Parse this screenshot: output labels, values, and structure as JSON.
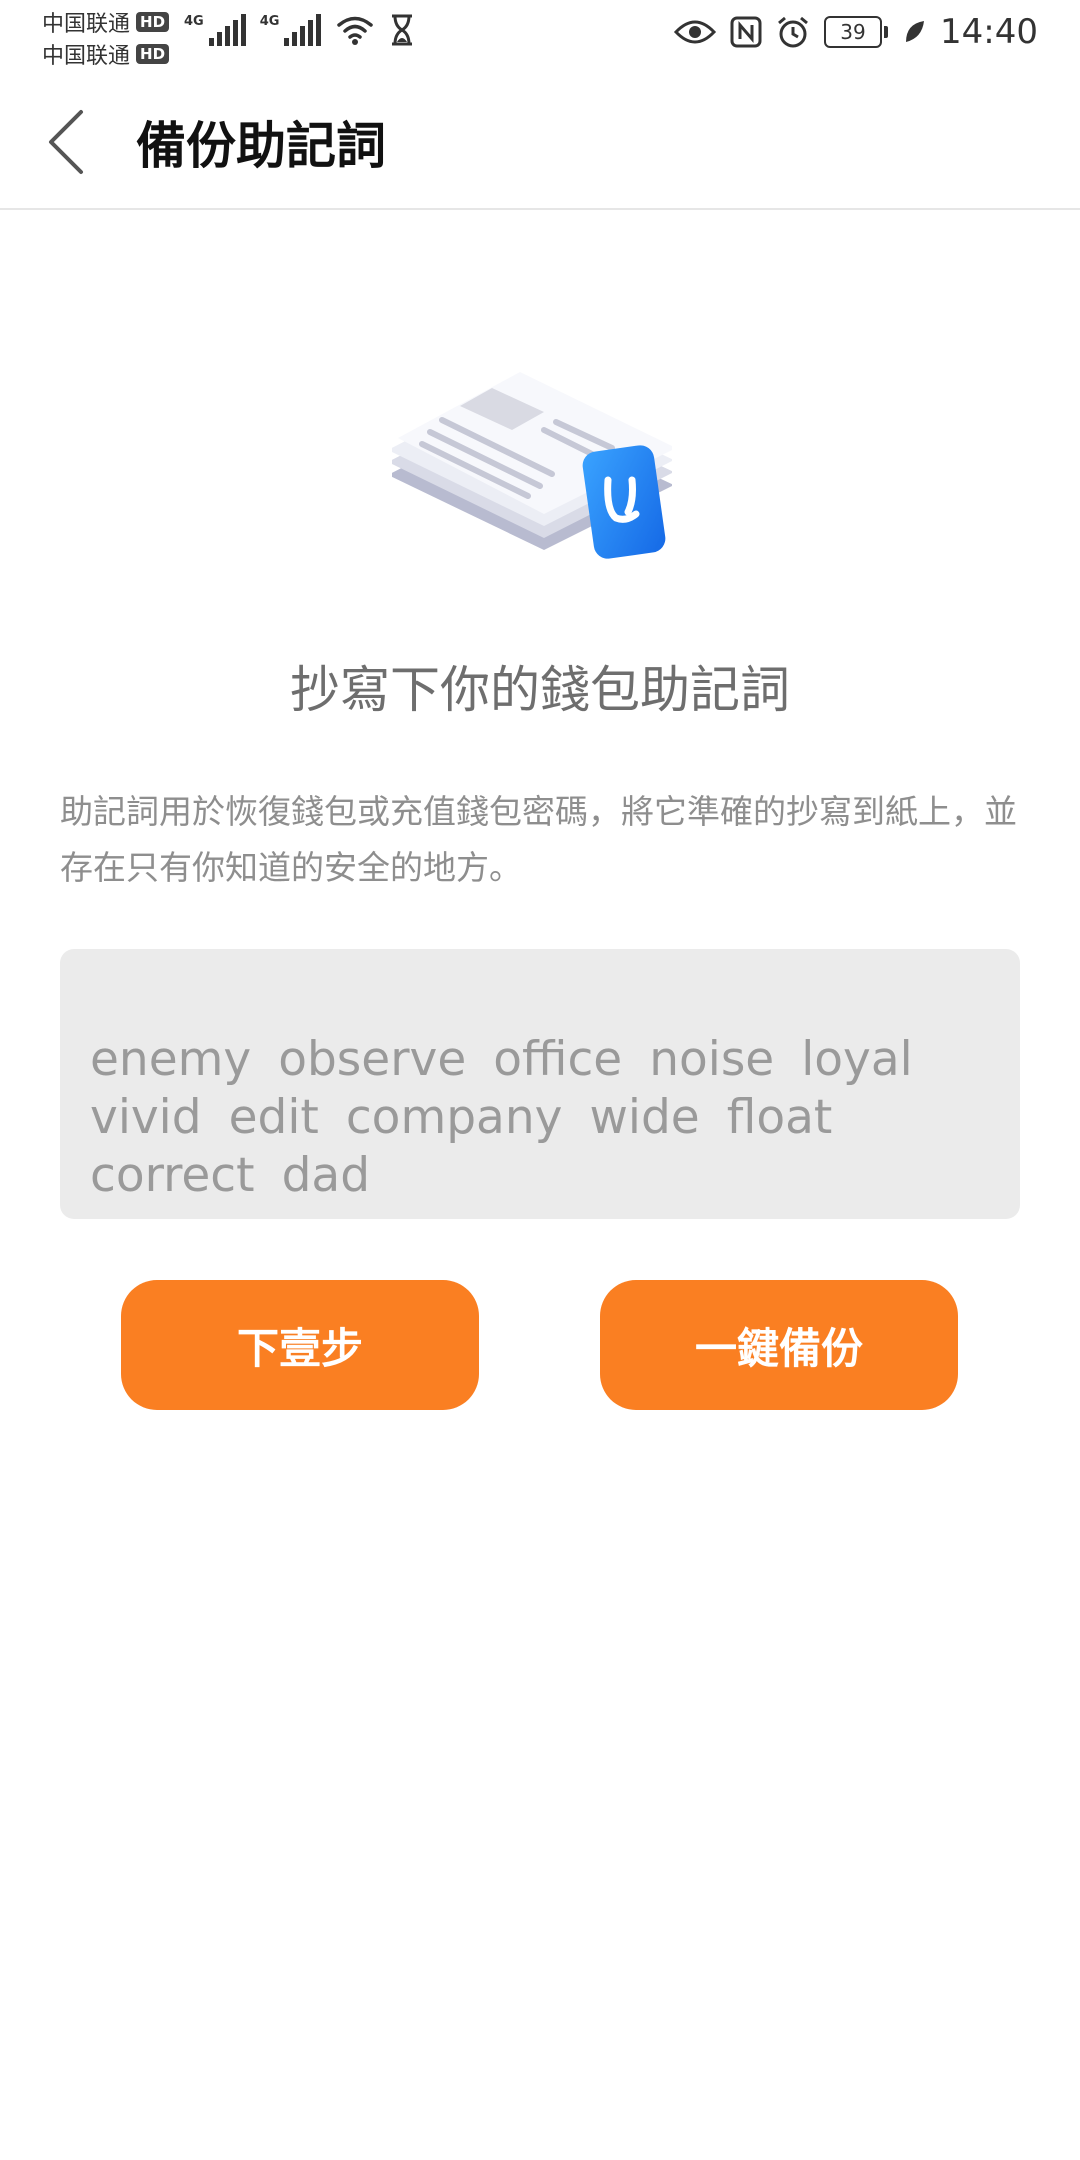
{
  "status_bar": {
    "carriers": [
      {
        "name": "中国联通",
        "badge": "HD"
      },
      {
        "name": "中国联通",
        "badge": "HD"
      }
    ],
    "network_1": "4G",
    "network_2": "4G",
    "battery_level": "39",
    "time": "14:40",
    "icons": [
      "signal-icon",
      "signal-icon",
      "wifi-icon",
      "hourglass-icon",
      "eye-icon",
      "nfc-icon",
      "alarm-icon",
      "battery-icon",
      "leaf-icon"
    ]
  },
  "header": {
    "title": "備份助記詞",
    "back_icon": "chevron-left-icon"
  },
  "main": {
    "illustration_icon": "document-stack-wallet-icon",
    "heading": "抄寫下你的錢包助記詞",
    "description": "助記詞用於恢復錢包或充值錢包密碼，將它準確的抄寫到紙上，並存在只有你知道的安全的地方。",
    "mnemonic_words": [
      "enemy",
      "observe",
      "office",
      "noise",
      "loyal",
      "vivid",
      "edit",
      "company",
      "wide",
      "float",
      "correct",
      "dad"
    ]
  },
  "buttons": {
    "next_label": "下壹步",
    "backup_label": "一鍵備份"
  },
  "colors": {
    "accent": "#fa7f22",
    "mnemonic_bg": "#ebebeb",
    "text_gray": "#8e8e8e"
  }
}
